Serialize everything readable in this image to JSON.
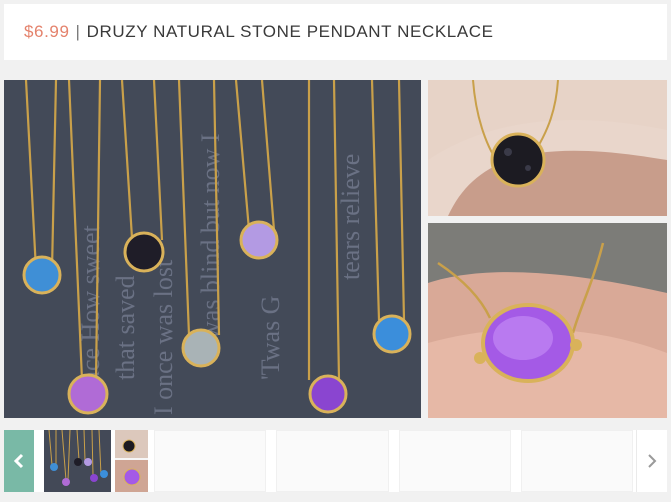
{
  "header": {
    "price": "$6.99",
    "separator": "|",
    "title": "DRUZY NATURAL STONE PENDANT NECKLACE"
  },
  "photo_text": {
    "line1": "Grace How sweet",
    "line2": "that saved",
    "line3": "I once was lost",
    "line4": "'Twas G",
    "line5": "was blind but now I",
    "line6": "tears relieve"
  },
  "icons": {
    "prev": "chevron-left-icon",
    "next": "chevron-right-icon"
  },
  "colors": {
    "price": "#e4826c",
    "prev_button": "#79b9a6"
  }
}
